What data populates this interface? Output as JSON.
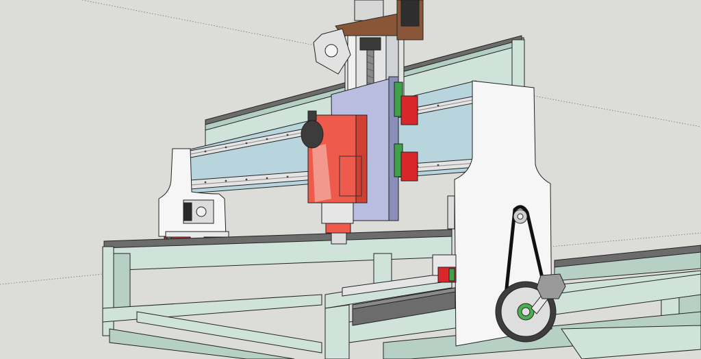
{
  "scene": {
    "colors": {
      "background": "#dcdcd8",
      "extrusion": "#cfe3da",
      "extrusion_dark": "#9fbfb1",
      "rail": "#b8d4dc",
      "spindle": "#ee5a4b",
      "z_plate": "#b9bde0",
      "gantry_plate": "#f6f6f6",
      "wood_plate": "#8a5638",
      "rack": "#6c6c6c",
      "block_red": "#d8262a",
      "block_green": "#3fa24a"
    }
  }
}
